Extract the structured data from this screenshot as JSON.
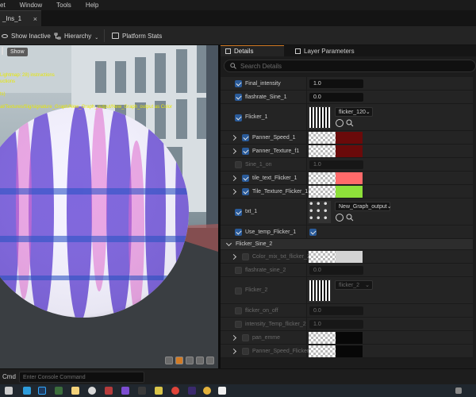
{
  "menubar": {
    "items": [
      "et",
      "Window",
      "Tools",
      "Help"
    ]
  },
  "tab": {
    "title": "_Ins_1",
    "close_glyph": "×"
  },
  "toolbar": {
    "show_inactive_label": "Show Inactive",
    "hierarchy_label": "Hierarchy",
    "platform_stats_label": "Platform Stats"
  },
  "viewport": {
    "show_label": "Show",
    "debug_lines": [
      "Lightmap: 28) instructions",
      "uctions",
      "ts)",
      "al/Textures/Sig/signature_Graph/New_Graph_output/New_Graph_output as Color"
    ]
  },
  "details": {
    "tabs": [
      "Details",
      "Layer Parameters"
    ],
    "search_placeholder": "Search Details",
    "rows": [
      {
        "name": "Final_intensity",
        "checked": true,
        "value": "1.0",
        "type": "number"
      },
      {
        "name": "flashrate_Sine_1",
        "checked": true,
        "value": "0.0",
        "type": "number"
      },
      {
        "name": "Flicker_1",
        "checked": true,
        "type": "texture",
        "dropdown": "flicker_120"
      },
      {
        "name": "Panner_Speed_1",
        "checked": true,
        "expand": true,
        "type": "color",
        "color": "#6a0a0a"
      },
      {
        "name": "Panner_Texture_f1",
        "checked": true,
        "expand": true,
        "type": "color",
        "color": "#6a0a0a"
      },
      {
        "name": "Sine_1_on",
        "checked": false,
        "value": "1.0",
        "type": "number",
        "dim": true
      },
      {
        "name": "tile_text_Flicker_1",
        "checked": true,
        "expand": true,
        "type": "color",
        "color": "#ff6a6a"
      },
      {
        "name": "Tile_Texture_Flicker_1",
        "checked": true,
        "expand": true,
        "type": "color",
        "color": "#8ee03a"
      },
      {
        "name": "txt_1",
        "checked": true,
        "type": "texture",
        "dropdown": "New_Graph_output"
      },
      {
        "name": "Use_temp_Flicker_1",
        "checked": true,
        "type": "bool"
      },
      {
        "category": "Flicker_Sine_2"
      },
      {
        "name": "Color_mix_txt_flicker_2",
        "checked": false,
        "expand": true,
        "type": "color",
        "color": "#ffffff",
        "dim": true
      },
      {
        "name": "flashrate_sine_2",
        "checked": false,
        "value": "0.0",
        "type": "number",
        "dim": true
      },
      {
        "name": "Flicker_2",
        "checked": false,
        "type": "texture",
        "dropdown": "flicker_2",
        "dim": true
      },
      {
        "name": "flicker_on_off",
        "checked": false,
        "value": "0.0",
        "type": "number",
        "dim": true
      },
      {
        "name": "intensity_Temp_flicker_2",
        "checked": false,
        "value": "1.0",
        "type": "number",
        "dim": true
      },
      {
        "name": "pan_emme",
        "checked": false,
        "expand": true,
        "type": "color",
        "color": "#000000",
        "dim": true
      },
      {
        "name": "Panner_Speed_Flicker_",
        "checked": false,
        "expand": true,
        "type": "color",
        "color": "#000000",
        "dim": true
      }
    ]
  },
  "console": {
    "label": "Cmd",
    "placeholder": "Enter Console Command"
  },
  "colors": {
    "accent": "#2a5b9a",
    "panel": "#242424",
    "background": "#151515"
  }
}
